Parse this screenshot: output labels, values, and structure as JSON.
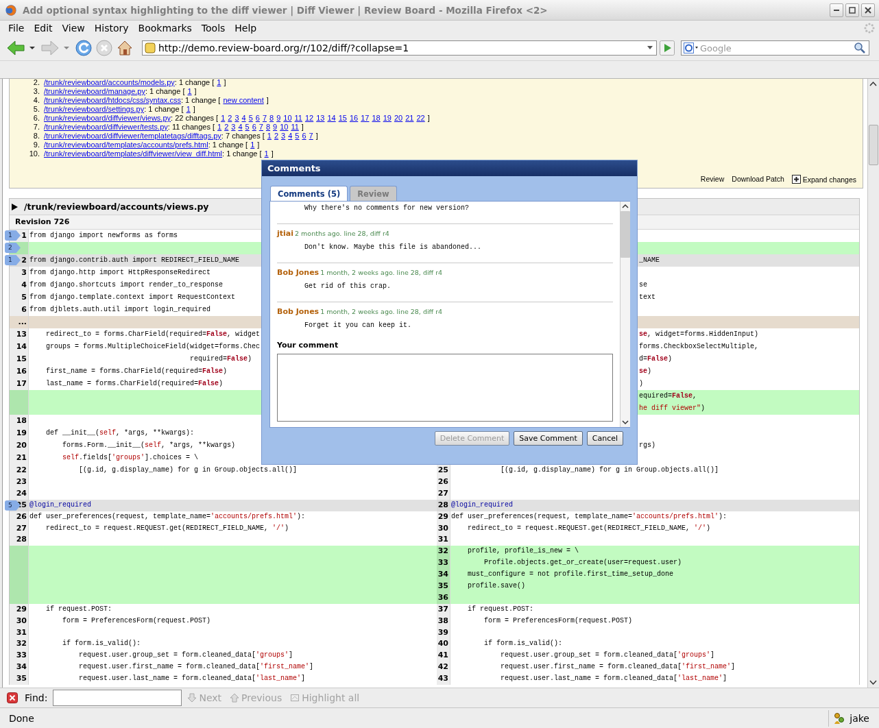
{
  "window": {
    "title": "Add optional syntax highlighting to the diff viewer | Diff Viewer | Review Board - Mozilla Firefox <2>"
  },
  "menu": [
    "File",
    "Edit",
    "View",
    "History",
    "Bookmarks",
    "Tools",
    "Help"
  ],
  "toolbar": {
    "url": "http://demo.review-board.org/r/102/diff/?collapse=1",
    "search_placeholder": "Google"
  },
  "file_list": [
    {
      "number": "2.",
      "path": "/trunk/reviewboard/accounts/models.py",
      "summary": ": 1 change [",
      "chunks": [
        "1"
      ],
      "end": "]"
    },
    {
      "number": "3.",
      "path": "/trunk/reviewboard/manage.py",
      "summary": ": 1 change [",
      "chunks": [
        "1"
      ],
      "end": "]"
    },
    {
      "number": "4.",
      "path": "/trunk/reviewboard/htdocs/css/syntax.css",
      "summary": ": 1 change [",
      "chunks": [
        "new content"
      ],
      "end": "]"
    },
    {
      "number": "5.",
      "path": "/trunk/reviewboard/settings.py",
      "summary": ": 1 change [",
      "chunks": [
        "1"
      ],
      "end": "]"
    },
    {
      "number": "6.",
      "path": "/trunk/reviewboard/diffviewer/views.py",
      "summary": ": 22 changes [",
      "chunks": [
        "1",
        "2",
        "3",
        "4",
        "5",
        "6",
        "7",
        "8",
        "9",
        "10",
        "11",
        "12",
        "13",
        "14",
        "15",
        "16",
        "17",
        "18",
        "19",
        "20",
        "21",
        "22"
      ],
      "end": "]"
    },
    {
      "number": "7.",
      "path": "/trunk/reviewboard/diffviewer/tests.py",
      "summary": ": 11 changes [",
      "chunks": [
        "1",
        "2",
        "3",
        "4",
        "5",
        "6",
        "7",
        "8",
        "9",
        "10",
        "11"
      ],
      "end": "]"
    },
    {
      "number": "8.",
      "path": "/trunk/reviewboard/diffviewer/templatetags/difftags.py",
      "summary": ": 7 changes [",
      "chunks": [
        "1",
        "2",
        "3",
        "4",
        "5",
        "6",
        "7"
      ],
      "end": "]"
    },
    {
      "number": "9.",
      "path": "/trunk/reviewboard/templates/accounts/prefs.html",
      "summary": ": 1 change [",
      "chunks": [
        "1"
      ],
      "end": "]"
    },
    {
      "number": "10.",
      "path": "/trunk/reviewboard/templates/diffviewer/view_diff.html",
      "summary": ": 1 change [",
      "chunks": [
        "1"
      ],
      "end": "]"
    }
  ],
  "file_actions": [
    {
      "label": "Review",
      "kind": "link"
    },
    {
      "label": "Download Patch",
      "kind": "link"
    },
    {
      "label": "Expand changes",
      "kind": "expand"
    }
  ],
  "diff": {
    "path": "/trunk/reviewboard/accounts/views.py",
    "revision": "Revision 726",
    "rows": [
      {
        "kind": "equal",
        "badge": "1",
        "left_num": "1",
        "left": "from django import newforms as forms"
      },
      {
        "kind": "insert",
        "badge": "2"
      },
      {
        "kind": "commented",
        "badge": "1",
        "left_num": "2",
        "left": "from django.contrib.auth import REDIRECT_FIELD_NAME",
        "right": "_NAME",
        "right_clipped": true
      },
      {
        "kind": "equal",
        "left_num": "3",
        "left": "from django.http import HttpResponseRedirect"
      },
      {
        "kind": "equal",
        "left_num": "4",
        "left": "from django.shortcuts import render_to_response",
        "right": "se",
        "right_clipped": true
      },
      {
        "kind": "equal",
        "left_num": "5",
        "left": "from django.template.context import RequestContext",
        "right": "text",
        "right_clipped": true
      },
      {
        "kind": "equal",
        "left_num": "6",
        "left": "from djblets.auth.util import login_required"
      },
      {
        "kind": "collapsed",
        "left_num": "..."
      },
      {
        "kind": "equal",
        "left_num": "13",
        "left": [
          "    redirect_to = forms.CharField(required=",
          {
            "kind": "keyword",
            "text": "False"
          },
          ", widget"
        ],
        "right": [
          {
            "kind": "keyword",
            "text": "se"
          },
          ", widget=forms.HiddenInput)"
        ],
        "right_clipped": true
      },
      {
        "kind": "equal",
        "left_num": "14",
        "left": "    groups = forms.MultipleChoiceField(widget=forms.Chec",
        "right": "forms.CheckboxSelectMultiple,",
        "right_clipped": true
      },
      {
        "kind": "equal",
        "left_num": "15",
        "left": [
          "                                       required=",
          {
            "kind": "keyword",
            "text": "False"
          },
          ")"
        ],
        "right": [
          "d=",
          {
            "kind": "keyword",
            "text": "False"
          },
          ")"
        ],
        "right_clipped": true
      },
      {
        "kind": "equal",
        "left_num": "16",
        "left": [
          "    first_name = forms.CharField(required=",
          {
            "kind": "keyword",
            "text": "False"
          },
          ")"
        ],
        "right": [
          {
            "kind": "keyword",
            "text": "se"
          },
          ")"
        ],
        "right_clipped": true
      },
      {
        "kind": "equal",
        "left_num": "17",
        "left": [
          "    last_name = forms.CharField(required=",
          {
            "kind": "keyword",
            "text": "False"
          },
          ")"
        ],
        "right": ")",
        "right_clipped": true
      },
      {
        "kind": "insert",
        "right": [
          "equired=",
          {
            "kind": "keyword",
            "text": "False"
          },
          ","
        ],
        "right_clipped": true
      },
      {
        "kind": "insert",
        "right": [
          {
            "kind": "string",
            "text": "he diff viewer\""
          },
          ")"
        ],
        "right_clipped": true
      },
      {
        "kind": "equal",
        "left_num": "18"
      },
      {
        "kind": "equal",
        "left_num": "19",
        "left": [
          "    def __init__(",
          {
            "kind": "builtin",
            "text": "self"
          },
          ", *args, **kwargs):"
        ]
      },
      {
        "kind": "equal",
        "left_num": "20",
        "left": [
          "        forms.Form.__init__(",
          {
            "kind": "builtin",
            "text": "self"
          },
          ", *args, **kwargs)"
        ],
        "right": "rgs)",
        "right_clipped": true
      },
      {
        "kind": "equal",
        "left_num": "21",
        "left": [
          {
            "kind": "builtin",
            "text": "        self"
          },
          ".fields[",
          {
            "kind": "string",
            "text": "'groups'"
          },
          "].choices = \\"
        ]
      },
      {
        "kind": "equal",
        "left_num": "22",
        "left": "            [(g.id, g.display_name) for g in Group.objects.all()]",
        "right_num": "25",
        "right": "            [(g.id, g.display_name) for g in Group.objects.all()]"
      },
      {
        "kind": "equal",
        "left_num": "23",
        "right_num": "26"
      },
      {
        "kind": "equal",
        "left_num": "24",
        "right_num": "27"
      },
      {
        "kind": "commented",
        "badge": "5",
        "left_num": "25",
        "left": [
          {
            "kind": "decorator",
            "text": "@login_required"
          }
        ],
        "right_num": "28",
        "right": [
          {
            "kind": "decorator",
            "text": "@login_required"
          }
        ]
      },
      {
        "kind": "equal",
        "left_num": "26",
        "left": [
          "def user_preferences(request, template_name=",
          {
            "kind": "string",
            "text": "'accounts/prefs.html'"
          },
          "):"
        ],
        "right_num": "29",
        "right": [
          "def user_preferences(request, template_name=",
          {
            "kind": "string",
            "text": "'accounts/prefs.html'"
          },
          "):"
        ]
      },
      {
        "kind": "equal",
        "left_num": "27",
        "left": [
          "    redirect_to = request.REQUEST.get(REDIRECT_FIELD_NAME, ",
          {
            "kind": "string",
            "text": "'/'"
          },
          ")"
        ],
        "right_num": "30",
        "right": [
          "    redirect_to = request.REQUEST.get(REDIRECT_FIELD_NAME, ",
          {
            "kind": "string",
            "text": "'/'"
          },
          ")"
        ]
      },
      {
        "kind": "equal",
        "left_num": "28",
        "right_num": "31"
      },
      {
        "kind": "insert",
        "right_num": "32",
        "right": "    profile, profile_is_new = \\"
      },
      {
        "kind": "insert",
        "right_num": "33",
        "right": "        Profile.objects.get_or_create(user=request.user)"
      },
      {
        "kind": "insert",
        "right_num": "34",
        "right": "    must_configure = not profile.first_time_setup_done"
      },
      {
        "kind": "insert",
        "right_num": "35",
        "right": "    profile.save()"
      },
      {
        "kind": "insert",
        "right_num": "36"
      },
      {
        "kind": "equal",
        "left_num": "29",
        "left": "    if request.POST:",
        "right_num": "37",
        "right": "    if request.POST:"
      },
      {
        "kind": "equal",
        "left_num": "30",
        "left": "        form = PreferencesForm(request.POST)",
        "right_num": "38",
        "right": "        form = PreferencesForm(request.POST)"
      },
      {
        "kind": "equal",
        "left_num": "31",
        "right_num": "39"
      },
      {
        "kind": "equal",
        "left_num": "32",
        "left": "        if form.is_valid():",
        "right_num": "40",
        "right": "        if form.is_valid():"
      },
      {
        "kind": "equal",
        "left_num": "33",
        "left": [
          "            request.user.group_set = form.cleaned_data[",
          {
            "kind": "string",
            "text": "'groups'"
          },
          "]"
        ],
        "right_num": "41",
        "right": [
          "            request.user.group_set = form.cleaned_data[",
          {
            "kind": "string",
            "text": "'groups'"
          },
          "]"
        ]
      },
      {
        "kind": "equal",
        "left_num": "34",
        "left": [
          "            request.user.first_name = form.cleaned_data[",
          {
            "kind": "string",
            "text": "'first_name'"
          },
          "]"
        ],
        "right_num": "42",
        "right": [
          "            request.user.first_name = form.cleaned_data[",
          {
            "kind": "string",
            "text": "'first_name'"
          },
          "]"
        ]
      },
      {
        "kind": "equal",
        "left_num": "35",
        "left": [
          "            request.user.last_name = form.cleaned_data[",
          {
            "kind": "string",
            "text": "'last_name'"
          },
          "]"
        ],
        "right_num": "43",
        "right": [
          "            request.user.last_name = form.cleaned_data[",
          {
            "kind": "string",
            "text": "'last_name'"
          },
          "]"
        ]
      }
    ]
  },
  "dialog": {
    "title": "Comments",
    "tabs": [
      {
        "label": "Comments (5)",
        "selected": true
      },
      {
        "label": "Review",
        "selected": false
      }
    ],
    "comments": [
      {
        "text": "Why there's no comments for new version?"
      },
      {
        "author": "jtiai",
        "meta": "2 months ago. line 28, diff r4",
        "text": "Don't know. Maybe this file is abandoned..."
      },
      {
        "author": "Bob Jones",
        "meta": "1 month, 2 weeks ago. line 28, diff r4",
        "text": "Get rid of this crap."
      },
      {
        "author": "Bob Jones",
        "meta": "1 month, 2 weeks ago. line 28, diff r4",
        "text": "Forget it you can keep it."
      }
    ],
    "comment_label": "Your comment",
    "buttons": [
      {
        "label": "Delete Comment",
        "disabled": true
      },
      {
        "label": "Save Comment",
        "disabled": false
      },
      {
        "label": "Cancel",
        "disabled": false
      }
    ]
  },
  "find_bar": {
    "label": "Find:",
    "buttons": [
      {
        "label": "Next",
        "kind": "next",
        "disabled": true
      },
      {
        "label": "Previous",
        "kind": "previous",
        "disabled": true
      },
      {
        "label": "Highlight all",
        "kind": "highlight",
        "disabled": true
      }
    ]
  },
  "status_bar": {
    "text": "Done",
    "user": "jake"
  }
}
